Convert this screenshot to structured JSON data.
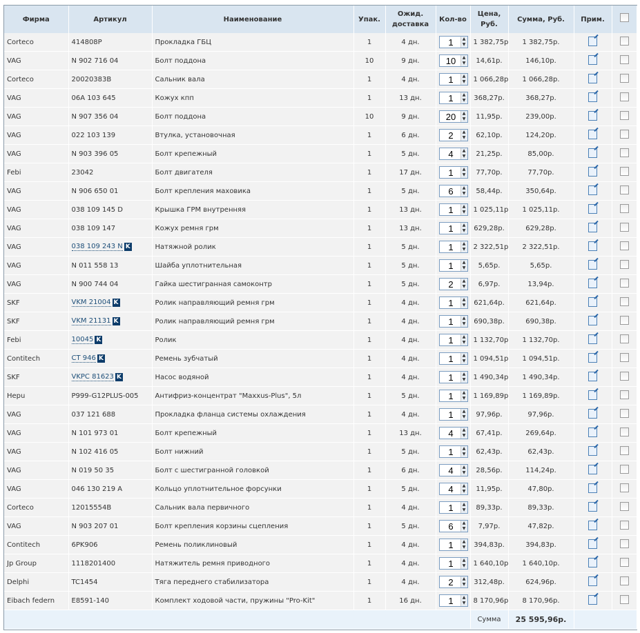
{
  "headers": {
    "firm": "Фирма",
    "article": "Артикул",
    "name": "Наименование",
    "pack": "Упак.",
    "delivery": "Ожид. доставка",
    "qty": "Кол-во",
    "price": "Цена, Руб.",
    "sum": "Сумма, Руб.",
    "note": "Прим."
  },
  "catalog_badge": "K",
  "rows": [
    [
      "Corteco",
      "414808P",
      false,
      "Прокладка ГБЦ",
      "1",
      "4 дн.",
      "1",
      "1 382,75р.",
      "1 382,75р."
    ],
    [
      "VAG",
      "N 902 716 04",
      false,
      "Болт поддона",
      "10",
      "9 дн.",
      "10",
      "14,61р.",
      "146,10р."
    ],
    [
      "Corteco",
      "20020383B",
      false,
      "Сальник вала",
      "1",
      "4 дн.",
      "1",
      "1 066,28р.",
      "1 066,28р."
    ],
    [
      "VAG",
      "06A 103 645",
      false,
      "Кожух кпп",
      "1",
      "13 дн.",
      "1",
      "368,27р.",
      "368,27р."
    ],
    [
      "VAG",
      "N 907 356 04",
      false,
      "Болт поддона",
      "10",
      "9 дн.",
      "20",
      "11,95р.",
      "239,00р."
    ],
    [
      "VAG",
      "022 103 139",
      false,
      "Втулка, установочная",
      "1",
      "6 дн.",
      "2",
      "62,10р.",
      "124,20р."
    ],
    [
      "VAG",
      "N 903 396 05",
      false,
      "Болт крепежный",
      "1",
      "5 дн.",
      "4",
      "21,25р.",
      "85,00р."
    ],
    [
      "Febi",
      "23042",
      false,
      "Болт двигателя",
      "1",
      "17 дн.",
      "1",
      "77,70р.",
      "77,70р."
    ],
    [
      "VAG",
      "N 906 650 01",
      false,
      "Болт крепления маховика",
      "1",
      "5 дн.",
      "6",
      "58,44р.",
      "350,64р."
    ],
    [
      "VAG",
      "038 109 145 D",
      false,
      "Крышка ГРМ внутренняя",
      "1",
      "13 дн.",
      "1",
      "1 025,11р.",
      "1 025,11р."
    ],
    [
      "VAG",
      "038 109 147",
      false,
      "Кожух ремня грм",
      "1",
      "13 дн.",
      "1",
      "629,28р.",
      "629,28р."
    ],
    [
      "VAG",
      "038 109 243 N",
      true,
      "Натяжной ролик",
      "1",
      "5 дн.",
      "1",
      "2 322,51р.",
      "2 322,51р."
    ],
    [
      "VAG",
      "N 011 558 13",
      false,
      "Шайба уплотнительная",
      "1",
      "5 дн.",
      "1",
      "5,65р.",
      "5,65р."
    ],
    [
      "VAG",
      "N 900 744 04",
      false,
      "Гайка шестигранная самоконтр",
      "1",
      "5 дн.",
      "2",
      "6,97р.",
      "13,94р."
    ],
    [
      "SKF",
      "VKM 21004",
      true,
      "Ролик направляющий ремня грм",
      "1",
      "4 дн.",
      "1",
      "621,64р.",
      "621,64р."
    ],
    [
      "SKF",
      "VKM 21131",
      true,
      "Ролик направляющий ремня грм",
      "1",
      "4 дн.",
      "1",
      "690,38р.",
      "690,38р."
    ],
    [
      "Febi",
      "10045",
      true,
      "Ролик",
      "1",
      "4 дн.",
      "1",
      "1 132,70р.",
      "1 132,70р."
    ],
    [
      "Contitech",
      "CT 946",
      true,
      "Ремень зубчатый",
      "1",
      "4 дн.",
      "1",
      "1 094,51р.",
      "1 094,51р."
    ],
    [
      "SKF",
      "VKPC 81623",
      true,
      "Насос водяной",
      "1",
      "4 дн.",
      "1",
      "1 490,34р.",
      "1 490,34р."
    ],
    [
      "Hepu",
      "P999-G12PLUS-005",
      false,
      "Антифриз-концентрат \"Maxxus-Plus\", 5л",
      "1",
      "5 дн.",
      "1",
      "1 169,89р.",
      "1 169,89р."
    ],
    [
      "VAG",
      "037 121 688",
      false,
      "Прокладка фланца системы охлаждения",
      "1",
      "4 дн.",
      "1",
      "97,96р.",
      "97,96р."
    ],
    [
      "VAG",
      "N 101 973 01",
      false,
      "Болт крепежный",
      "1",
      "13 дн.",
      "4",
      "67,41р.",
      "269,64р."
    ],
    [
      "VAG",
      "N 102 416 05",
      false,
      "Болт нижний",
      "1",
      "5 дн.",
      "1",
      "62,43р.",
      "62,43р."
    ],
    [
      "VAG",
      "N 019 50 35",
      false,
      "Болт с шестигранной головкой",
      "1",
      "6 дн.",
      "4",
      "28,56р.",
      "114,24р."
    ],
    [
      "VAG",
      "046 130 219 A",
      false,
      "Кольцо уплотнительное форсунки",
      "1",
      "5 дн.",
      "4",
      "11,95р.",
      "47,80р."
    ],
    [
      "Corteco",
      "12015554B",
      false,
      "Сальник вала первичного",
      "1",
      "4 дн.",
      "1",
      "89,33р.",
      "89,33р."
    ],
    [
      "VAG",
      "N 903 207 01",
      false,
      "Болт крепления корзины сцепления",
      "1",
      "5 дн.",
      "6",
      "7,97р.",
      "47,82р."
    ],
    [
      "Contitech",
      "6PK906",
      false,
      "Ремень поликлиновый",
      "1",
      "4 дн.",
      "1",
      "394,83р.",
      "394,83р."
    ],
    [
      "Jp Group",
      "1118201400",
      false,
      "Натяжитель ремня приводного",
      "1",
      "4 дн.",
      "1",
      "1 640,10р.",
      "1 640,10р."
    ],
    [
      "Delphi",
      "TC1454",
      false,
      "Тяга переднего стабилизатора",
      "1",
      "4 дн.",
      "2",
      "312,48р.",
      "624,96р."
    ],
    [
      "Eibach federn",
      "E8591-140",
      false,
      "Комплект ходовой части, пружины \"Pro-Kit\"",
      "1",
      "16 дн.",
      "1",
      "8 170,96р.",
      "8 170,96р."
    ]
  ],
  "footer": {
    "label": "Сумма",
    "total": "25 595,96р."
  }
}
